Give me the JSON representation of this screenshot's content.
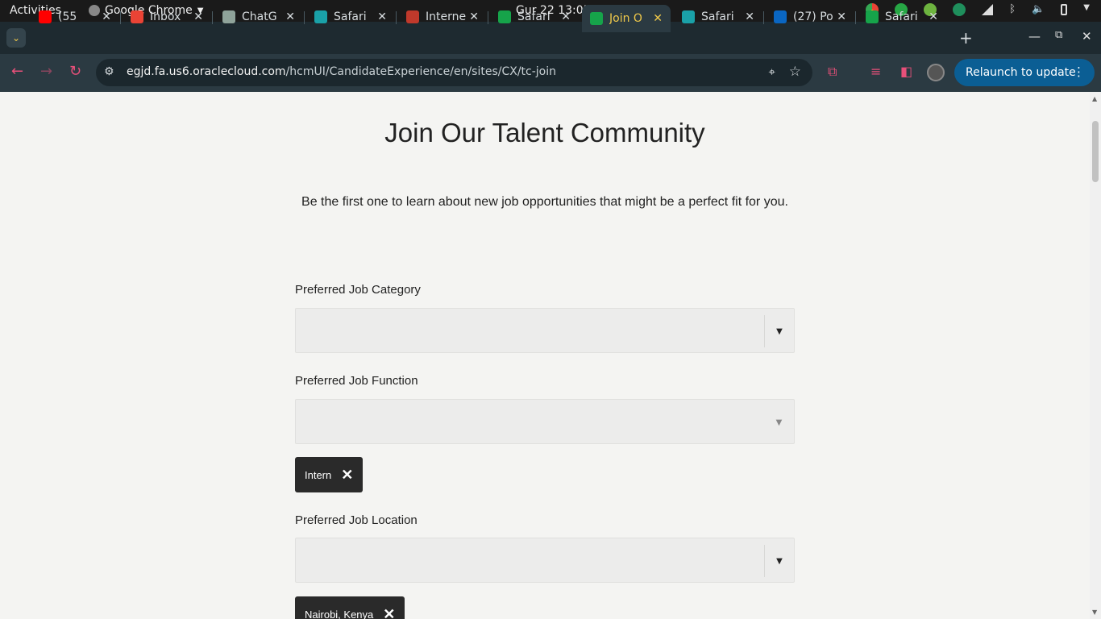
{
  "system_bar": {
    "activities": "Activities",
    "app_name": "Google Chrome",
    "clock": "Gur 22  13:05"
  },
  "tabs": [
    {
      "label": "(55",
      "color": "#ff0000"
    },
    {
      "label": "Inbox",
      "color": "#ea4335"
    },
    {
      "label": "ChatG",
      "color": "#8fa39a"
    },
    {
      "label": "Safari",
      "color": "#1aa1a8"
    },
    {
      "label": "Interne",
      "color": "#c0392b"
    },
    {
      "label": "Safari",
      "color": "#16a34a"
    },
    {
      "label": "Join O",
      "color": "#16a34a",
      "active": true
    },
    {
      "label": "Safari",
      "color": "#1aa1a8"
    },
    {
      "label": "(27) Po",
      "color": "#0a66c2"
    },
    {
      "label": "Safari",
      "color": "#16a34a"
    }
  ],
  "tab_close": "✕",
  "browser": {
    "url_host": "egjd.fa.us6.oraclecloud.com",
    "url_path": "/hcmUI/CandidateExperience/en/sites/CX/tc-join",
    "relaunch_label": "Relaunch to update"
  },
  "page": {
    "title": "Join Our Talent Community",
    "subtitle": "Be the first one to learn about new job opportunities that might be a perfect fit for you.",
    "category_label": "Preferred Job Category",
    "category_value": "",
    "function_label": "Preferred Job Function",
    "function_value": "",
    "function_chip": "Intern",
    "location_label": "Preferred Job Location",
    "location_value": "",
    "location_chip": "Nairobi, Kenya"
  },
  "icons": {
    "dropdown_arrow": "▼",
    "chip_remove": "✕"
  }
}
